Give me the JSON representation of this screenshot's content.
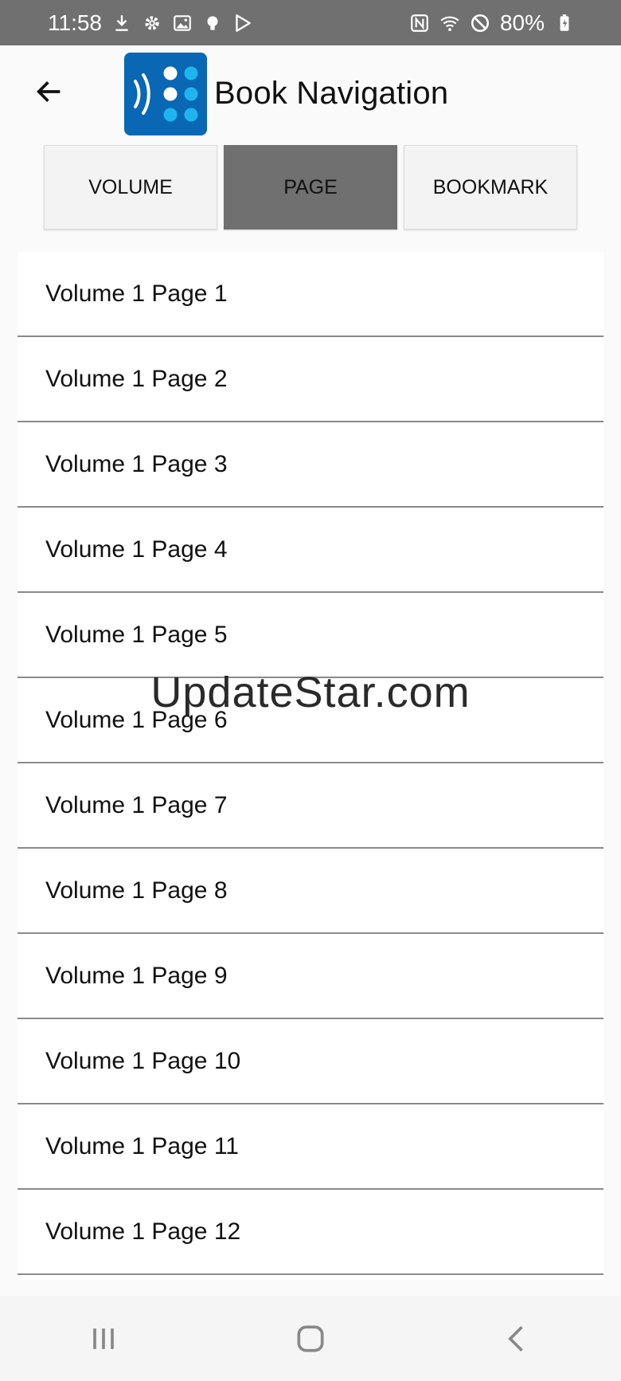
{
  "status_bar": {
    "time": "11:58",
    "battery": "80%",
    "left_icons": [
      "download-icon",
      "gear-icon",
      "image-icon",
      "bulb-icon",
      "play-store-icon"
    ],
    "right_icons": [
      "nfc-icon",
      "wifi-icon",
      "do-not-disturb-icon",
      "battery-charging-icon"
    ]
  },
  "header": {
    "title": "Book Navigation",
    "back_icon": "arrow-left-icon",
    "logo_icon": "braille-app-logo"
  },
  "tabs": [
    {
      "label": "VOLUME",
      "active": false
    },
    {
      "label": "PAGE",
      "active": true
    },
    {
      "label": "BOOKMARK",
      "active": false
    }
  ],
  "list": {
    "items": [
      "Volume 1 Page 1",
      "Volume 1 Page 2",
      "Volume 1 Page 3",
      "Volume 1 Page 4",
      "Volume 1 Page 5",
      "Volume 1 Page 6",
      "Volume 1 Page 7",
      "Volume 1 Page 8",
      "Volume 1 Page 9",
      "Volume 1 Page 10",
      "Volume 1 Page 11",
      "Volume 1 Page 12"
    ]
  },
  "watermark": "UpdateStar.com",
  "nav_bar": {
    "icons": [
      "recent-apps-icon",
      "home-icon",
      "back-nav-icon"
    ]
  },
  "colors": {
    "status_bar_bg": "#707070",
    "active_tab_bg": "#707070",
    "logo_bg": "#0a67b3",
    "logo_dot": "#1fb4f0"
  }
}
